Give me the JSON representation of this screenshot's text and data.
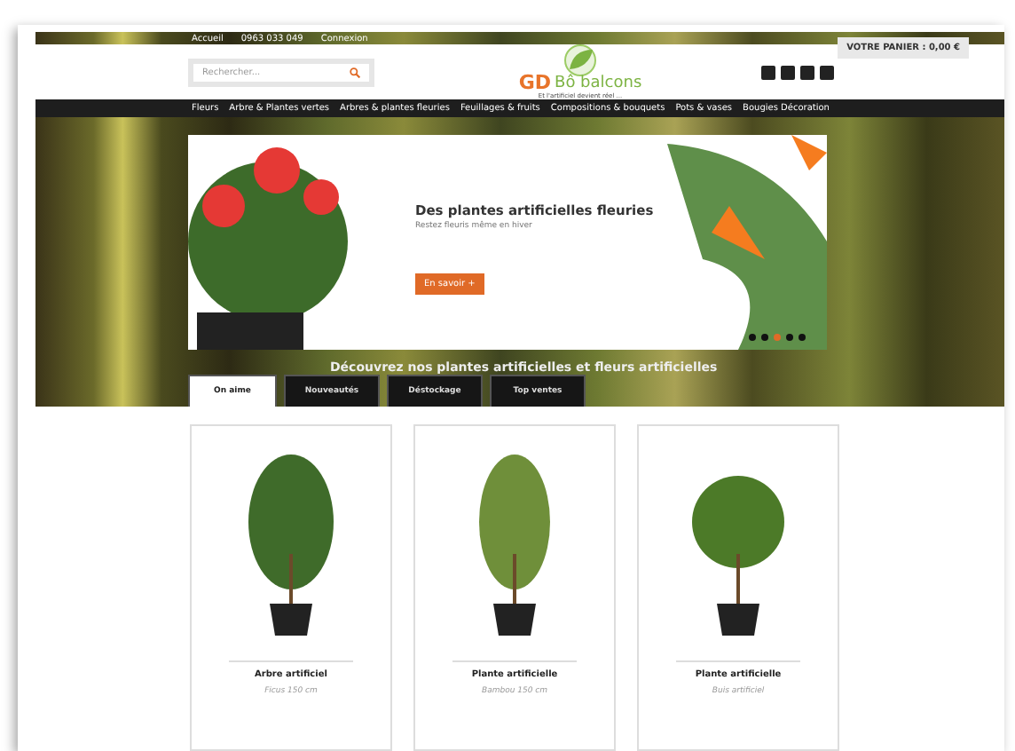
{
  "top_bar": {
    "links": [
      "Accueil",
      "0963 033 049",
      "Connexion"
    ],
    "cart": "VOTRE PANIER : 0,00 €"
  },
  "header": {
    "search": {
      "placeholder": "Rechercher..."
    },
    "logo": {
      "initials": "GD",
      "name": "Bô balcons",
      "tagline": "Et l'artificiel devient réel ..."
    }
  },
  "nav": [
    "Fleurs",
    "Arbre & Plantes vertes",
    "Arbres & plantes fleuries",
    "Feuillages & fruits",
    "Compositions & bouquets",
    "Pots & vases",
    "Bougies Décoration"
  ],
  "slider": {
    "title": "Des plantes artificielles fleuries",
    "subtitle": "Restez fleuris même en hiver",
    "button": "En savoir +",
    "dots": [
      {
        "selected": false
      },
      {
        "selected": false
      },
      {
        "selected": true
      },
      {
        "selected": false
      },
      {
        "selected": false
      }
    ]
  },
  "heading": "Découvrez nos plantes artificielles et fleurs artificielles",
  "tabs": [
    {
      "label": "On aime",
      "selected": true
    },
    {
      "label": "Nouveautés",
      "selected": false
    },
    {
      "label": "Déstockage",
      "selected": false
    },
    {
      "label": "Top ventes",
      "selected": false
    }
  ],
  "products": [
    {
      "name": "Arbre artificiel",
      "detail": "Ficus 150 cm"
    },
    {
      "name": "Plante artificielle",
      "detail": "Bambou 150 cm"
    },
    {
      "name": "Plante artificielle",
      "detail": "Buis artificiel"
    }
  ]
}
